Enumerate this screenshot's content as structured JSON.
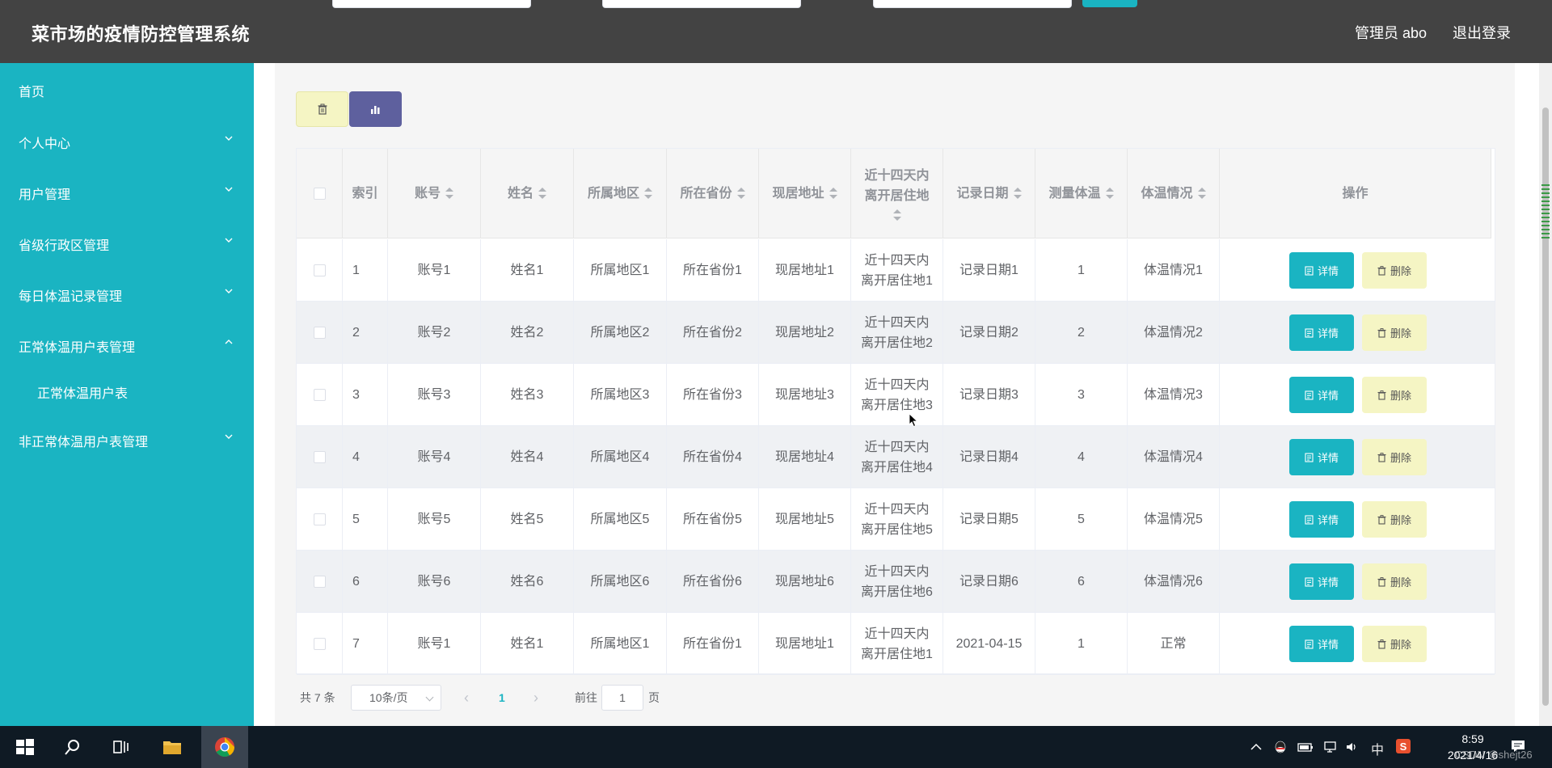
{
  "header": {
    "title": "菜市场的疫情防控管理系统",
    "user": "管理员 abo",
    "logout": "退出登录"
  },
  "sidebar": {
    "items": [
      {
        "label": "首页",
        "expandable": false
      },
      {
        "label": "个人中心",
        "expandable": true,
        "expanded": false
      },
      {
        "label": "用户管理",
        "expandable": true,
        "expanded": false
      },
      {
        "label": "省级行政区管理",
        "expandable": true,
        "expanded": false
      },
      {
        "label": "每日体温记录管理",
        "expandable": true,
        "expanded": false
      },
      {
        "label": "正常体温用户表管理",
        "expandable": true,
        "expanded": true
      },
      {
        "label": "正常体温用户表",
        "sub": true
      },
      {
        "label": "非正常体温用户表管理",
        "expandable": true,
        "expanded": false
      }
    ]
  },
  "table": {
    "headers": {
      "index": "索引",
      "account": "账号",
      "name": "姓名",
      "area": "所属地区",
      "province": "所在省份",
      "address": "现居地址",
      "left14": "近十四天内离开居住地",
      "date": "记录日期",
      "temp": "测量体温",
      "status": "体温情况",
      "ops": "操作"
    },
    "rows": [
      {
        "index": "1",
        "account": "账号1",
        "name": "姓名1",
        "area": "所属地区1",
        "province": "所在省份1",
        "address": "现居地址1",
        "left14": "近十四天内离开居住地1",
        "date": "记录日期1",
        "temp": "1",
        "status": "体温情况1"
      },
      {
        "index": "2",
        "account": "账号2",
        "name": "姓名2",
        "area": "所属地区2",
        "province": "所在省份2",
        "address": "现居地址2",
        "left14": "近十四天内离开居住地2",
        "date": "记录日期2",
        "temp": "2",
        "status": "体温情况2"
      },
      {
        "index": "3",
        "account": "账号3",
        "name": "姓名3",
        "area": "所属地区3",
        "province": "所在省份3",
        "address": "现居地址3",
        "left14": "近十四天内离开居住地3",
        "date": "记录日期3",
        "temp": "3",
        "status": "体温情况3"
      },
      {
        "index": "4",
        "account": "账号4",
        "name": "姓名4",
        "area": "所属地区4",
        "province": "所在省份4",
        "address": "现居地址4",
        "left14": "近十四天内离开居住地4",
        "date": "记录日期4",
        "temp": "4",
        "status": "体温情况4"
      },
      {
        "index": "5",
        "account": "账号5",
        "name": "姓名5",
        "area": "所属地区5",
        "province": "所在省份5",
        "address": "现居地址5",
        "left14": "近十四天内离开居住地5",
        "date": "记录日期5",
        "temp": "5",
        "status": "体温情况5"
      },
      {
        "index": "6",
        "account": "账号6",
        "name": "姓名6",
        "area": "所属地区6",
        "province": "所在省份6",
        "address": "现居地址6",
        "left14": "近十四天内离开居住地6",
        "date": "记录日期6",
        "temp": "6",
        "status": "体温情况6"
      },
      {
        "index": "7",
        "account": "账号1",
        "name": "姓名1",
        "area": "所属地区1",
        "province": "所在省份1",
        "address": "现居地址1",
        "left14": "近十四天内离开居住地1",
        "date": "2021-04-15",
        "temp": "1",
        "status": "正常"
      }
    ],
    "detail_label": "详情",
    "delete_label": "删除"
  },
  "pagination": {
    "total": "共 7 条",
    "page_size": "10条/页",
    "current_page": "1",
    "goto_label": "前往",
    "goto_value": "1",
    "page_label": "页"
  },
  "taskbar": {
    "ime": "中",
    "time": "8:59",
    "date": "2021/4/16",
    "watermark": "CSDN @shejt26"
  },
  "colors": {
    "header_bg": "#434343",
    "sidebar_bg": "#1ab4c2",
    "accent": "#1ab4c2",
    "stat_button": "#5e609e",
    "delete_button": "#f5f5c4"
  }
}
